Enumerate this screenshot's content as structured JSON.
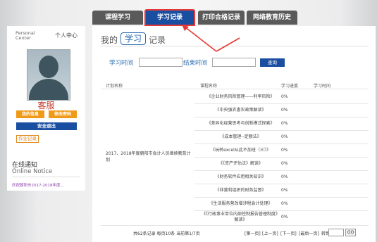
{
  "tabs": [
    {
      "label": "课程学习"
    },
    {
      "label": "学习记录"
    },
    {
      "label": "打印合格记录"
    },
    {
      "label": "网络教育历史"
    }
  ],
  "sidebar": {
    "personal_center_en_1": "Personal",
    "personal_center_en_2": "Center",
    "personal_center_cn": "个人中心",
    "username": "客服",
    "my_info_button": "我的信息",
    "change_password_button": "修改密码",
    "logout_button": "安全退出",
    "homework_link": "作业记录",
    "notice_title": "在线通知",
    "notice_title_en": "Online Notice",
    "notice_item": "庆祝朝阳市2017-2018年度..."
  },
  "main": {
    "title_prefix": "我的",
    "title_badge": "学习",
    "title_suffix": "记录",
    "study_time_label": "学习时间",
    "end_time_label": "结束时间",
    "study_time_value": "",
    "end_time_value": "",
    "search_button": "查询",
    "headers": {
      "plan": "计划名称",
      "course": "课程名称",
      "progress": "学习进度",
      "time": "学习时间"
    },
    "plan_name": "2017、2018年度朝阳市会计人员继续教育计划",
    "rows": [
      {
        "course": "《企业财务风险管理——利率风险》",
        "progress": "0%"
      },
      {
        "course": "《中央强农惠农政策解读》",
        "progress": "0%"
      },
      {
        "course": "《差异化经营思考与创新模式探索》",
        "progress": "0%"
      },
      {
        "course": "《成本管理--定额法》",
        "progress": "0%"
      },
      {
        "course": "《玩转excel从此不加班（三）》",
        "progress": "0%"
      },
      {
        "course": "《《资产评估法》解读》",
        "progress": "0%"
      },
      {
        "course": "《财务软件应用相关知识》",
        "progress": "0%"
      },
      {
        "course": "《非营利组织的财务监督》",
        "progress": "0%"
      },
      {
        "course": "《生活服务营改增涉税会计处理》",
        "progress": "0%"
      },
      {
        "course": "《《行政事业单位内部控制报告管理制度》解读》",
        "progress": "0%"
      }
    ]
  },
  "pager": {
    "summary": "共62条记录 每页10条 当前第1/7页",
    "first": "[第一页]",
    "prev": "[上一页]",
    "next": "[下一页]",
    "last": "[最后一页]",
    "goto": "转到",
    "page_input": "",
    "go": "GO"
  }
}
